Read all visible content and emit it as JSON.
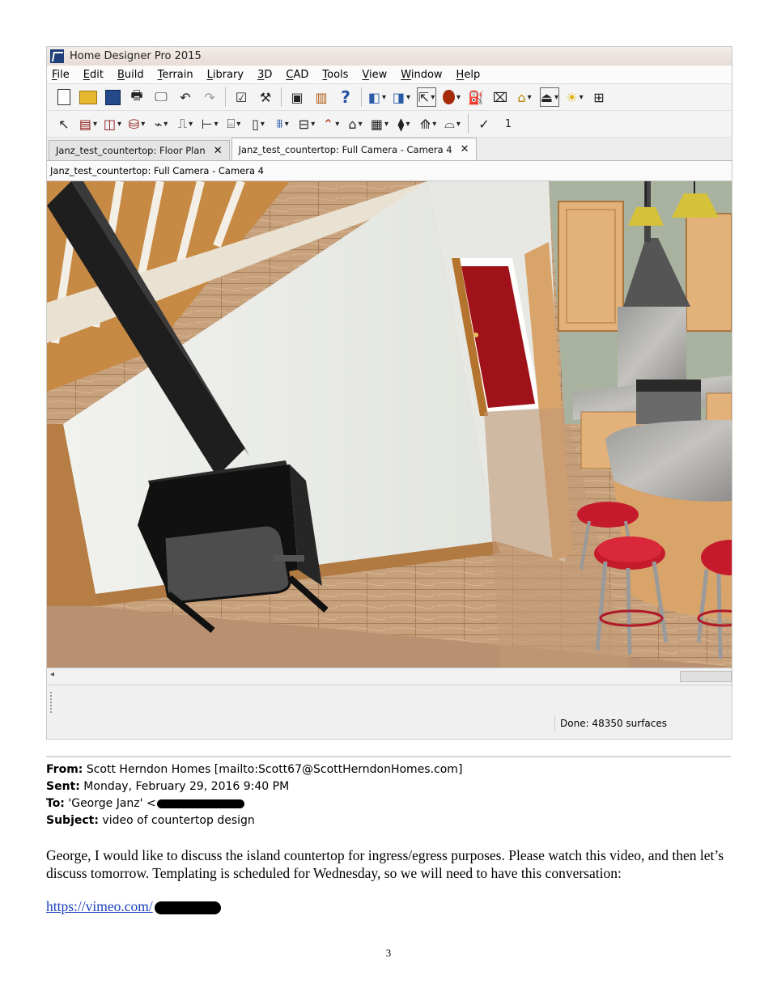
{
  "app": {
    "title": "Home Designer Pro 2015",
    "menu": [
      "File",
      "Edit",
      "Build",
      "Terrain",
      "Library",
      "3D",
      "CAD",
      "Tools",
      "View",
      "Window",
      "Help"
    ],
    "tabs": [
      {
        "label": "Janz_test_countertop: Floor Plan",
        "close": "✕"
      },
      {
        "label": "Janz_test_countertop: Full Camera - Camera 4",
        "close": "✕"
      }
    ],
    "view_title": "Janz_test_countertop: Full Camera - Camera 4",
    "toolbar_value": "1",
    "status": "Done:  48350 surfaces"
  },
  "email": {
    "from_label": "From:",
    "from_value": "Scott Herndon Homes [mailto:Scott67@ScottHerndonHomes.com]",
    "sent_label": "Sent:",
    "sent_value": "Monday, February 29, 2016 9:40 PM",
    "to_label": "To:",
    "to_value": "'George Janz' <",
    "subject_label": "Subject:",
    "subject_value": "video of countertop design",
    "body": "George, I would like to discuss the island countertop for ingress/egress purposes. Please watch this video, and then let’s discuss tomorrow. Templating is scheduled for Wednesday, so we will need to have this conversation:",
    "link": "https://vimeo.com/"
  },
  "page_number": "3",
  "colors": {
    "floor": "#c7a07c",
    "wall": "#e9ebe7",
    "stove": "#1c1c1c",
    "door": "#a0121a",
    "cabinet": "#e3b27a",
    "stool": "#c41a2c",
    "link": "#1a3fbf"
  }
}
